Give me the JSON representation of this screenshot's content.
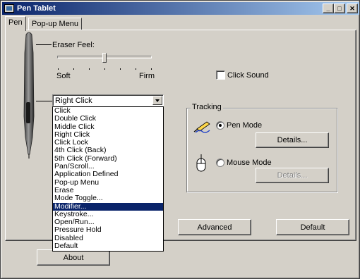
{
  "window": {
    "title": "Pen Tablet"
  },
  "tabs": [
    {
      "label": "Pen",
      "active": true
    },
    {
      "label": "Pop-up Menu",
      "active": false
    }
  ],
  "eraser": {
    "label": "Eraser Feel:",
    "min_label": "Soft",
    "max_label": "Firm",
    "level_fraction": 0.5
  },
  "click_sound": {
    "label": "Click Sound",
    "checked": false
  },
  "button_function": {
    "selected": "Right Click",
    "options": [
      "Click",
      "Double Click",
      "Middle Click",
      "Right Click",
      "Click Lock",
      "4th Click (Back)",
      "5th Click (Forward)",
      "Pan/Scroll...",
      "Application Defined",
      "Pop-up Menu",
      "Erase",
      "Mode Toggle...",
      "Modifier...",
      "Keystroke...",
      "Open/Run...",
      "Pressure Hold",
      "Disabled",
      "Default"
    ],
    "highlighted": "Modifier..."
  },
  "tracking": {
    "legend": "Tracking",
    "pen_mode_label": "Pen Mode",
    "pen_mode_checked": true,
    "pen_details_label": "Details...",
    "mouse_mode_label": "Mouse Mode",
    "mouse_mode_checked": false,
    "mouse_details_label": "Details..."
  },
  "buttons": {
    "advanced": "Advanced",
    "default": "Default",
    "about": "About"
  },
  "colors": {
    "title_start": "#0a246a",
    "title_end": "#a6caf0",
    "face": "#d4d0c8",
    "selection": "#0a246a"
  }
}
